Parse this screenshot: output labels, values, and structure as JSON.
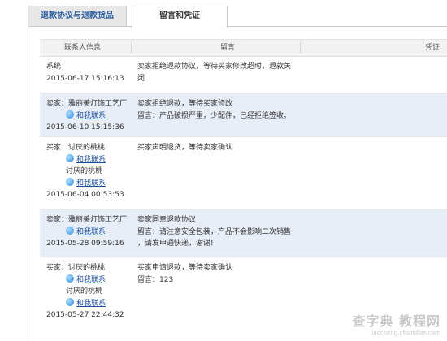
{
  "tabs": [
    {
      "label": "退款协议与退款货品"
    },
    {
      "label": "留言和凭证"
    }
  ],
  "columns": [
    "联系人信息",
    "留言",
    "凭证"
  ],
  "rows": [
    {
      "info": [
        "系统",
        "2015-06-17 15:16:13"
      ],
      "msg": [
        "卖家拒绝退款协议，等待买家修改超时，退款关",
        "闭"
      ]
    },
    {
      "info_a": "卖家：雅丽美灯饰工艺厂",
      "contact": "和我联系",
      "time": "2015-06-10 15:15:36",
      "msg": [
        "卖家拒绝退款，等待买家修改",
        "留言：产品破损严重，少配件，已经拒绝签收。"
      ]
    },
    {
      "info_a": "买家：讨厌的桃桃",
      "contact_a": "和我联系",
      "info_b": "讨厌的桃桃",
      "contact_b": "和我联系",
      "time": "2015-06-04 00:53:53",
      "msg": [
        "买家声明退货，等待卖家确认"
      ]
    },
    {
      "info_a": "卖家：雅丽美灯饰工艺厂",
      "contact": "和我联系",
      "time": "2015-05-28 09:59:16",
      "msg": [
        "卖家同意退款协议",
        "留言：请注意安全包装，产品不会影响二次销售",
        "，请发申通快递，谢谢!"
      ]
    },
    {
      "info_a": "买家：讨厌的桃桃",
      "contact_a": "和我联系",
      "info_b": "讨厌的桃桃",
      "contact_b": "和我联系",
      "time": "2015-05-27 22:44:32",
      "msg": [
        "买家申请退款，等待卖家确认",
        "留言：123"
      ]
    }
  ],
  "watermark": {
    "main": "查字典 教程网",
    "sub": "jiaocheng.chazidian.com"
  }
}
